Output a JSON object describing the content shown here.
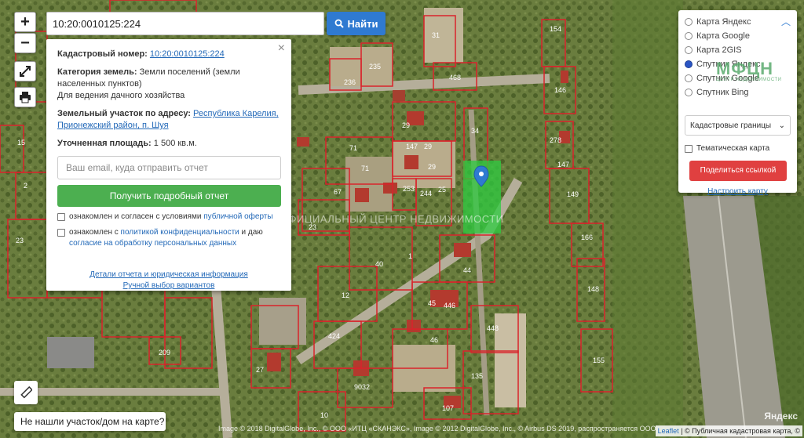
{
  "search": {
    "value": "10:20:0010125:224",
    "button_label": "Найти"
  },
  "map_controls": {
    "zoom_in": "+",
    "zoom_out": "−"
  },
  "info": {
    "cadastral_label": "Кадастровый номер:",
    "cadastral_value": "10:20:0010125:224",
    "category_label": "Категория земель:",
    "category_value": "Земли поселений (земли населенных пунктов)",
    "usage": "Для ведения дачного хозяйства",
    "address_label": "Земельный участок по адресу:",
    "address_value": "Республика Карелия, Прионежский район, п. Шуя",
    "area_label": "Уточненная площадь:",
    "area_value": "1 500 кв.м.",
    "email_placeholder": "Ваш email, куда отправить отчет",
    "report_button": "Получить подробный отчет",
    "consent1_text": "ознакомлен и согласен с условиями ",
    "consent1_link": "публичной оферты",
    "consent2_text": "ознакомлен с ",
    "consent2_link": "политикой конфиденциальности",
    "consent2_text2": " и даю ",
    "consent2_link2": "согласие на обработку персональных данных",
    "details_link": "Детали отчета и юридическая информация",
    "manual_link": "Ручной выбор вариантов",
    "close": "×"
  },
  "layers": {
    "options": [
      "Карта Яндекс",
      "Карта Google",
      "Карта 2GIS",
      "Спутник Яндекс",
      "Спутник Google",
      "Спутник Bing"
    ],
    "selected_index": 3,
    "logo": "МФЦН",
    "logo_sub": "ЦЕНТР НЕДВИЖИМОСТИ",
    "select_value": "Кадастровые границы",
    "thematic_label": "Тематическая карта",
    "share_button": "Поделиться ссылкой",
    "setup_link": "Настроить карту"
  },
  "not_found_button": "Не нашли участок/дом на карте?",
  "watermark": "ОФИЦИАЛЬНЫЙ ЦЕНТР НЕДВИЖИМОСТИ",
  "attribution": "Image © 2018 DigitalGlobe, Inc., © ООО «ИТЦ «СКАНЭКС», Image © 2012 DigitalGlobe, Inc., © Airbus DS 2019, распространяется ООО",
  "attribution_right": {
    "leaflet": "Leaflet",
    "text": " | © Публичная кадастровая карта, ©"
  },
  "yandex_logo": "Яндекс",
  "parcels": [
    "31",
    "154",
    "236",
    "235",
    "468",
    "146",
    "29",
    "34",
    "278",
    "147",
    "147",
    "71",
    "29",
    "29",
    "149",
    "67",
    "253",
    "244",
    "25",
    "71",
    "23",
    "166",
    "40",
    "1",
    "44",
    "12",
    "45",
    "446",
    "148",
    "424",
    "46",
    "448",
    "209",
    "27",
    "155",
    "135",
    "9032",
    "107",
    "10",
    "15",
    "2",
    "23"
  ],
  "colors": {
    "parcel_border": "#d9232b",
    "selected_parcel": "#2ecc40",
    "primary": "#2f7ad1",
    "report_green": "#4caf50",
    "share_red": "#e04040"
  }
}
